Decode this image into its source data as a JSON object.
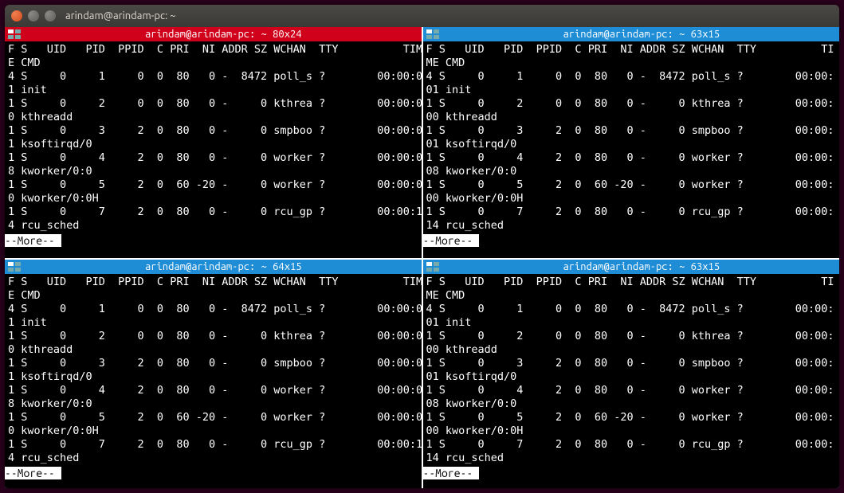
{
  "window": {
    "title": "arindam@arindam-pc: ~"
  },
  "icons": {
    "close": "×",
    "min": "–",
    "max": "▢"
  },
  "header_left": "F S   UID   PID  PPID  C PRI  NI ADDR SZ WCHAN  TTY          TIM",
  "header_left2": "E CMD",
  "header_right": "F S   UID   PID  PPID  C PRI  NI ADDR SZ WCHAN  TTY          TI",
  "header_right2": "ME CMD",
  "panes": [
    {
      "title": "arindam@arindam-pc: ~ 80x24",
      "active": true,
      "side": "left",
      "rows": [
        {
          "l1": "4 S     0     1     0  0  80   0 -  8472 poll_s ?        00:00:0",
          "l2": "1 init"
        },
        {
          "l1": "1 S     0     2     0  0  80   0 -     0 kthrea ?        00:00:0",
          "l2": "0 kthreadd"
        },
        {
          "l1": "1 S     0     3     2  0  80   0 -     0 smpboo ?        00:00:0",
          "l2": "1 ksoftirqd/0"
        },
        {
          "l1": "1 S     0     4     2  0  80   0 -     0 worker ?        00:00:0",
          "l2": "8 kworker/0:0"
        },
        {
          "l1": "1 S     0     5     2  0  60 -20 -     0 worker ?        00:00:0",
          "l2": "0 kworker/0:0H"
        },
        {
          "l1": "1 S     0     7     2  0  80   0 -     0 rcu_gp ?        00:00:1",
          "l2": "4 rcu_sched"
        }
      ]
    },
    {
      "title": "arindam@arindam-pc: ~ 63x15",
      "active": false,
      "side": "right",
      "rows": [
        {
          "l1": "4 S     0     1     0  0  80   0 -  8472 poll_s ?        00:00:",
          "l2": "01 init"
        },
        {
          "l1": "1 S     0     2     0  0  80   0 -     0 kthrea ?        00:00:",
          "l2": "00 kthreadd"
        },
        {
          "l1": "1 S     0     3     2  0  80   0 -     0 smpboo ?        00:00:",
          "l2": "01 ksoftirqd/0"
        },
        {
          "l1": "1 S     0     4     2  0  80   0 -     0 worker ?        00:00:",
          "l2": "08 kworker/0:0"
        },
        {
          "l1": "1 S     0     5     2  0  60 -20 -     0 worker ?        00:00:",
          "l2": "00 kworker/0:0H"
        },
        {
          "l1": "1 S     0     7     2  0  80   0 -     0 rcu_gp ?        00:00:",
          "l2": "14 rcu_sched"
        }
      ]
    },
    {
      "title": "arindam@arindam-pc: ~ 64x15",
      "active": false,
      "side": "left",
      "rows": [
        {
          "l1": "4 S     0     1     0  0  80   0 -  8472 poll_s ?        00:00:0",
          "l2": "1 init"
        },
        {
          "l1": "1 S     0     2     0  0  80   0 -     0 kthrea ?        00:00:0",
          "l2": "0 kthreadd"
        },
        {
          "l1": "1 S     0     3     2  0  80   0 -     0 smpboo ?        00:00:0",
          "l2": "1 ksoftirqd/0"
        },
        {
          "l1": "1 S     0     4     2  0  80   0 -     0 worker ?        00:00:0",
          "l2": "8 kworker/0:0"
        },
        {
          "l1": "1 S     0     5     2  0  60 -20 -     0 worker ?        00:00:0",
          "l2": "0 kworker/0:0H"
        },
        {
          "l1": "1 S     0     7     2  0  80   0 -     0 rcu_gp ?        00:00:1",
          "l2": "4 rcu_sched"
        }
      ]
    },
    {
      "title": "arindam@arindam-pc: ~ 63x15",
      "active": false,
      "side": "right",
      "rows": [
        {
          "l1": "4 S     0     1     0  0  80   0 -  8472 poll_s ?        00:00:",
          "l2": "01 init"
        },
        {
          "l1": "1 S     0     2     0  0  80   0 -     0 kthrea ?        00:00:",
          "l2": "00 kthreadd"
        },
        {
          "l1": "1 S     0     3     2  0  80   0 -     0 smpboo ?        00:00:",
          "l2": "01 ksoftirqd/0"
        },
        {
          "l1": "1 S     0     4     2  0  80   0 -     0 worker ?        00:00:",
          "l2": "08 kworker/0:0"
        },
        {
          "l1": "1 S     0     5     2  0  60 -20 -     0 worker ?        00:00:",
          "l2": "00 kworker/0:0H"
        },
        {
          "l1": "1 S     0     7     2  0  80   0 -     0 rcu_gp ?        00:00:",
          "l2": "14 rcu_sched"
        }
      ]
    }
  ],
  "more": "--More--"
}
